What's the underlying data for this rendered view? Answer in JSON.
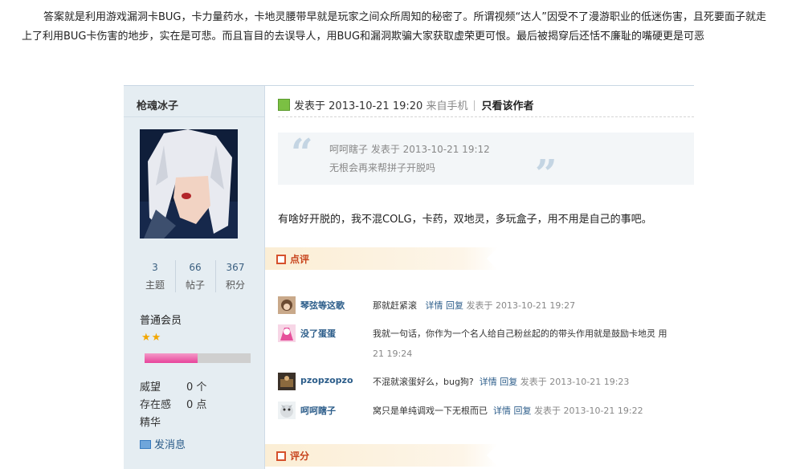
{
  "intro_text": "答案就是利用游戏漏洞卡BUG，卡力量药水，卡地灵腰带早就是玩家之间众所周知的秘密了。所谓视频“达人”因受不了漫游职业的低迷伤害，且死要面子就走 上了利用BUG卡伤害的地步，实在是可悲。而且盲目的去误导人，用BUG和漏洞欺骗大家获取虚荣更可恨。最后被揭穿后还恬不廉耻的嘴硬更是可恶",
  "author": {
    "name": "枪魂冰子",
    "stats": [
      {
        "num": "3",
        "label": "主题"
      },
      {
        "num": "66",
        "label": "帖子"
      },
      {
        "num": "367",
        "label": "积分"
      }
    ],
    "rank": "普通会员",
    "stars": "★★",
    "progress": 0.5,
    "fields": [
      {
        "k": "威望",
        "v": "0 个"
      },
      {
        "k": "存在感",
        "v": "0 点"
      },
      {
        "k": "精华",
        "v": ""
      }
    ],
    "pm_label": "发消息"
  },
  "post": {
    "posted_prefix": "发表于",
    "posted_time": "2013-10-21 19:20",
    "from_mobile": "来自手机",
    "only_author": "只看该作者",
    "quote_meta": "呵呵瞎子 发表于 2013-10-21 19:12",
    "quote_text": "无根会再来帮拼子开脱吗",
    "body": "有啥好开脱的，我不混COLG，卡药，双地灵，多玩盒子，用不用是自己的事吧。"
  },
  "comments_label": "点评",
  "rating_label": "评分",
  "comments": [
    {
      "name": "琴弦等这歌",
      "text": "那就赶紧滚",
      "detail": "详情",
      "reply": "回复",
      "meta": "发表于 2013-10-21 19:27",
      "wrap": ""
    },
    {
      "name": "没了蛋蛋",
      "text": "我就一句话，你作为一个名人给自己粉丝起的的带头作用就是鼓励卡地灵 用",
      "detail": "",
      "reply": "",
      "meta": "",
      "wrap": "21 19:24"
    },
    {
      "name": "pzopzopzo",
      "text": "不混就滚蛋好么，bug狗?",
      "detail": "详情",
      "reply": "回复",
      "meta": "发表于 2013-10-21 19:23",
      "wrap": ""
    },
    {
      "name": "呵呵瞎子",
      "text": "窝只是单纯调戏一下无根而已",
      "detail": "详情",
      "reply": "回复",
      "meta": "发表于 2013-10-21 19:22",
      "wrap": ""
    }
  ],
  "colors": {
    "sidebar_bg": "#e5edf2",
    "link_blue": "#2c5d8a",
    "section_red": "#c8441d",
    "progress_pink": "#e7439b"
  }
}
